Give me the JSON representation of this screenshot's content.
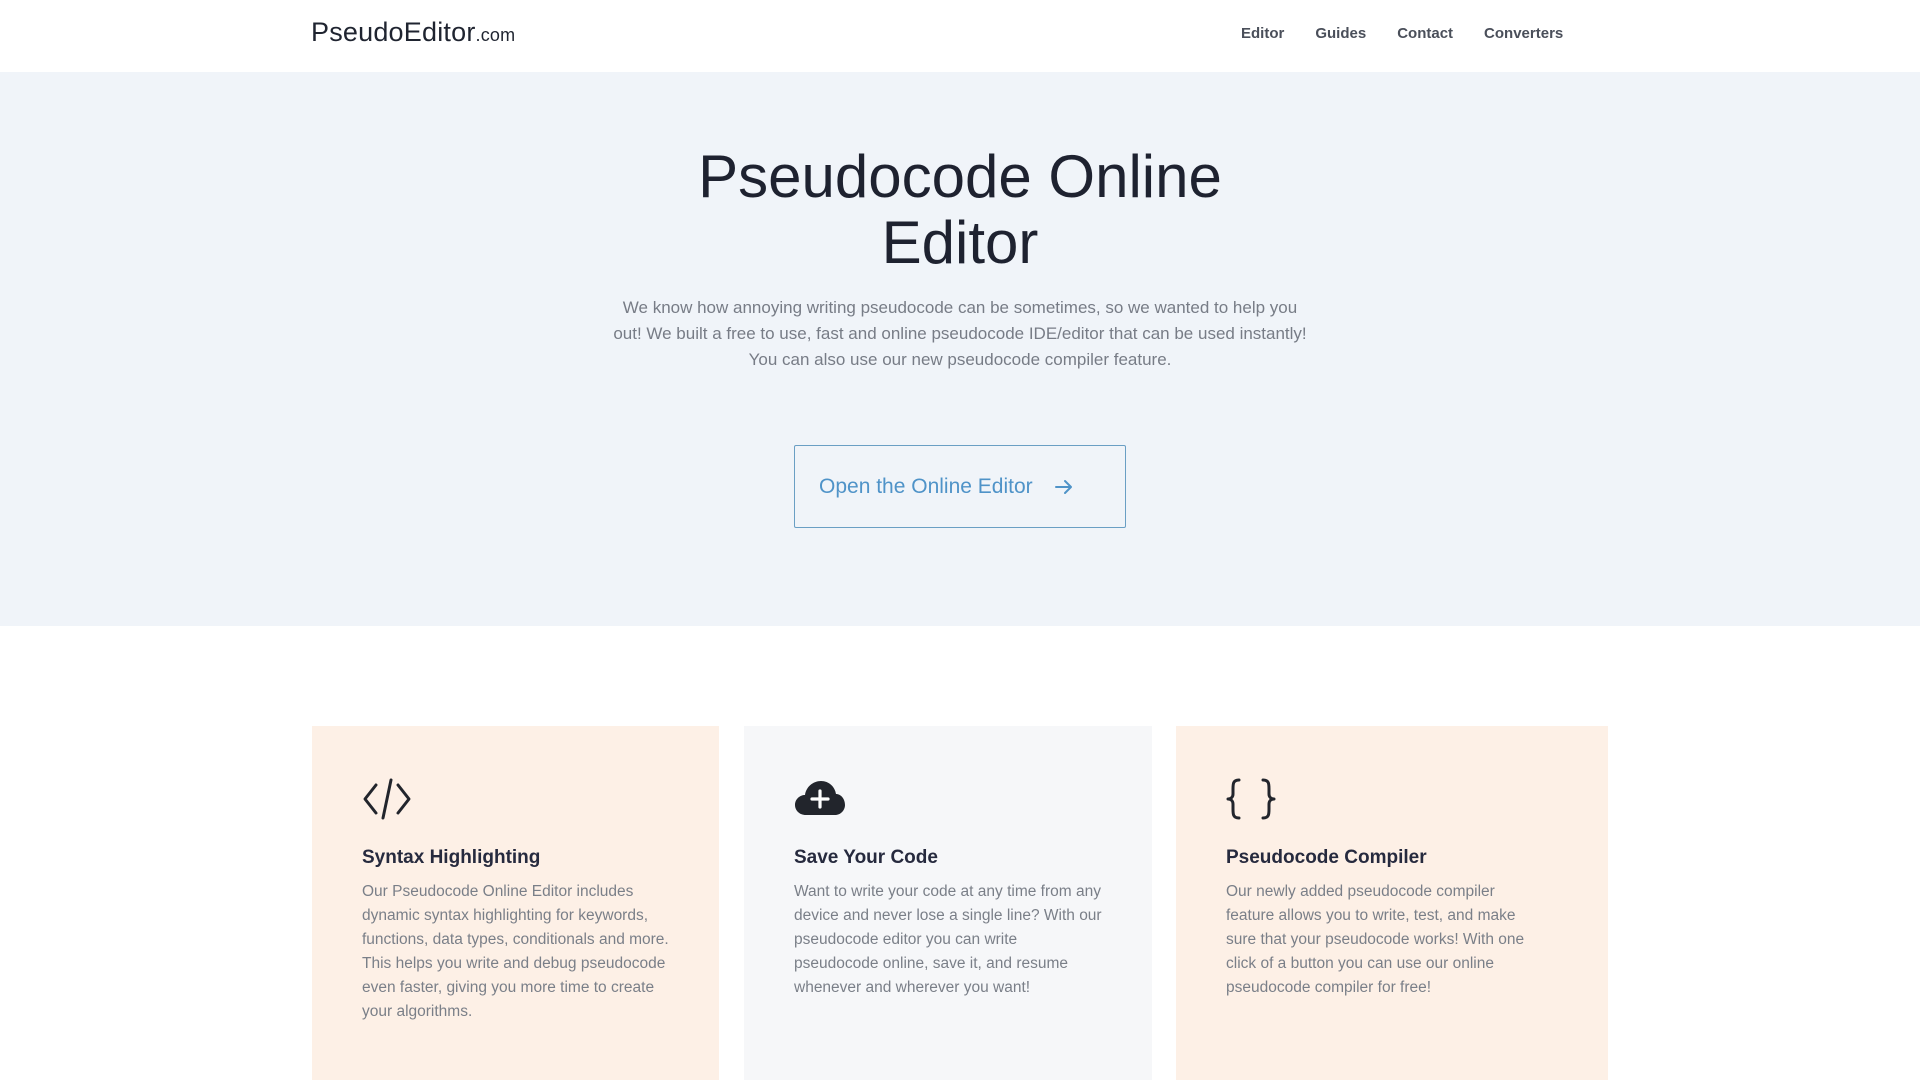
{
  "header": {
    "logo_main": "PseudoEditor",
    "logo_tld": ".com",
    "nav": [
      {
        "label": "Editor"
      },
      {
        "label": "Guides"
      },
      {
        "label": "Contact"
      },
      {
        "label": "Converters"
      }
    ]
  },
  "hero": {
    "title_line1": "Pseudocode Online",
    "title_line2": "Editor",
    "description": "We know how annoying writing pseudocode can be sometimes, so we wanted to help you out! We built a free to use, fast and online pseudocode IDE/editor that can be used instantly! You can also use our new pseudocode compiler feature.",
    "cta_label": "Open the Online Editor",
    "cta_icon": "arrow-right-icon"
  },
  "features": [
    {
      "icon": "code-brackets-icon",
      "title": "Syntax Highlighting",
      "text": "Our Pseudocode Online Editor includes dynamic syntax highlighting for keywords, functions, data types, conditionals and more. This helps you write and debug pseudocode even faster, giving you more time to create your algorithms."
    },
    {
      "icon": "cloud-plus-icon",
      "title": "Save Your Code",
      "text": "Want to write your code at any time from any device and never lose a single line? With our pseudocode editor you can write pseudocode online, save it, and resume whenever and wherever you want!"
    },
    {
      "icon": "curly-braces-icon",
      "title": "Pseudocode Compiler",
      "text": "Our newly added pseudocode compiler feature allows you to write, test, and make sure that your pseudocode works! With one click of a button you can use our online pseudocode compiler for free!"
    }
  ],
  "colors": {
    "hero_bg": "#f0f4f9",
    "accent": "#4f93c8",
    "card_warm": "#fdf0e6",
    "card_cool": "#f6f7f9"
  }
}
